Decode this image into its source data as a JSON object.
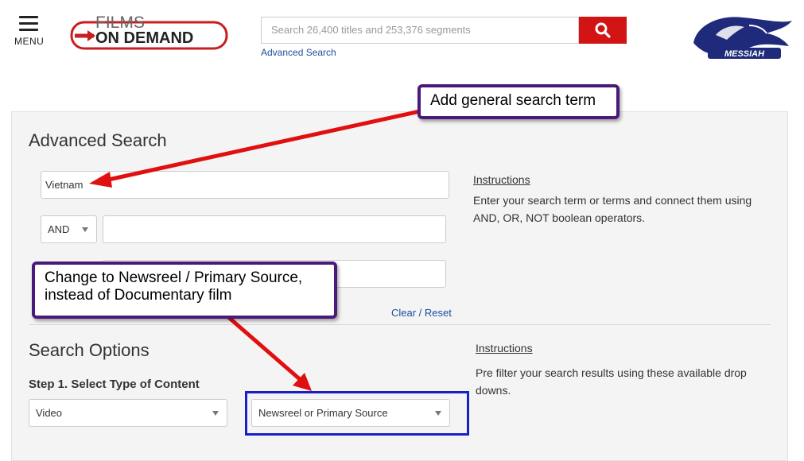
{
  "header": {
    "menu_label": "MENU",
    "logo_line1": "FILMS",
    "logo_line2": "ON DEMAND",
    "search_placeholder": "Search 26,400 titles and 253,376 segments",
    "advanced_search_link": "Advanced Search",
    "crest_text": "MESSIAH"
  },
  "advanced": {
    "title": "Advanced Search",
    "term1_value": "Vietnam",
    "operator": "AND",
    "term2_value": "",
    "clear_reset": "Clear / Reset",
    "instructions_title": "Instructions",
    "instructions_text": "Enter your search term or terms and connect them using AND, OR, NOT boolean operators."
  },
  "options": {
    "title": "Search Options",
    "step1_label": "Step 1. Select Type of Content",
    "type_select": "Video",
    "subtype_select": "Newsreel or Primary Source",
    "instructions_title": "Instructions",
    "instructions_text": "Pre filter your search results using these available drop downs."
  },
  "annotations": {
    "callout1": "Add general search term",
    "callout2_line1": "Change to Newsreel / Primary Source,",
    "callout2_line2": "instead of Documentary film",
    "arrow_color": "#e01010",
    "callout_border": "#4a1a7a",
    "highlight_border": "#1a20c8"
  }
}
